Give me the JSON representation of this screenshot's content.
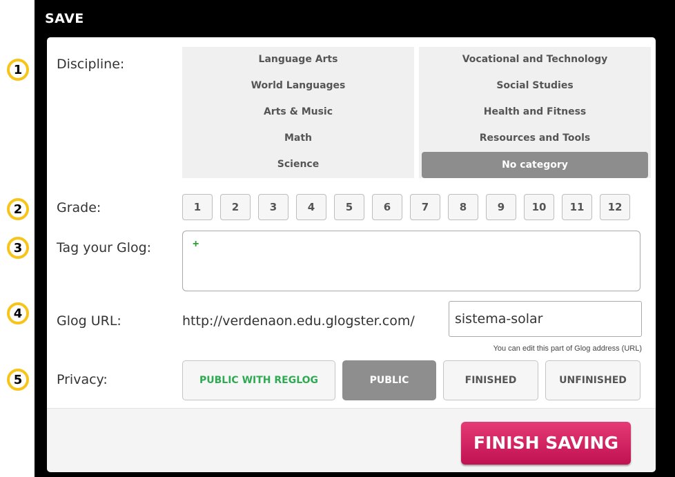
{
  "dialog": {
    "title": "SAVE"
  },
  "badges": [
    "1",
    "2",
    "3",
    "4",
    "5"
  ],
  "labels": {
    "discipline": "Discipline:",
    "grade": "Grade:",
    "tag": "Tag your Glog:",
    "url": "Glog URL:",
    "privacy": "Privacy:"
  },
  "discipline": {
    "left": [
      "Language Arts",
      "World Languages",
      "Arts & Music",
      "Math",
      "Science"
    ],
    "right": [
      "Vocational and Technology",
      "Social Studies",
      "Health and Fitness",
      "Resources and Tools",
      "No category"
    ],
    "selected": "No category"
  },
  "grades": [
    "1",
    "2",
    "3",
    "4",
    "5",
    "6",
    "7",
    "8",
    "9",
    "10",
    "11",
    "12"
  ],
  "tag": {
    "add_symbol": "+"
  },
  "url": {
    "prefix": "http://verdenaon.edu.glogster.com/",
    "value": "sistema-solar",
    "hint": "You can edit this part of Glog address (URL)"
  },
  "privacy": {
    "options": [
      "PUBLIC WITH REGLOG",
      "PUBLIC",
      "FINISHED",
      "UNFINISHED"
    ],
    "selected": "PUBLIC"
  },
  "footer": {
    "finish_label": "FINISH SAVING"
  },
  "colors": {
    "badge_border": "#f7c41a",
    "finish_button": "#d4215f",
    "selected_gray": "#8e8e8e",
    "reglog_green": "#2eaa52",
    "tag_plus_green": "#2e9e34"
  }
}
